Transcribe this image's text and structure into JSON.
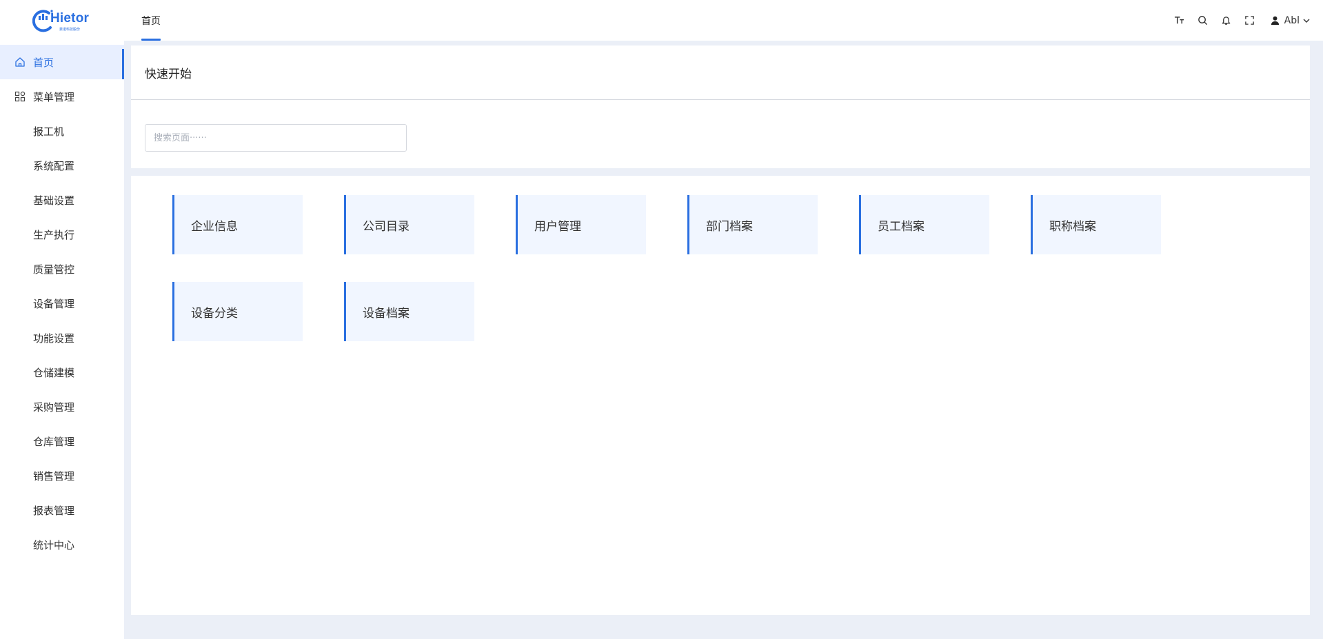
{
  "header": {
    "logo_text": "Hietor",
    "logo_subtext": "豪诺科技股份",
    "active_tab": "首页",
    "user_name": "Abl"
  },
  "sidebar": {
    "items": [
      {
        "label": "首页",
        "icon": "home-icon",
        "active": true
      },
      {
        "label": "菜单管理",
        "icon": "grid-icon",
        "active": false
      },
      {
        "label": "报工机"
      },
      {
        "label": "系统配置"
      },
      {
        "label": "基础设置"
      },
      {
        "label": "生产执行"
      },
      {
        "label": "质量管控"
      },
      {
        "label": "设备管理"
      },
      {
        "label": "功能设置"
      },
      {
        "label": "仓储建模"
      },
      {
        "label": "采购管理"
      },
      {
        "label": "仓库管理"
      },
      {
        "label": "销售管理"
      },
      {
        "label": "报表管理"
      },
      {
        "label": "统计中心"
      }
    ]
  },
  "main": {
    "title": "快速开始",
    "search": {
      "placeholder": "搜索页面······",
      "value": ""
    },
    "cards": [
      {
        "label": "企业信息"
      },
      {
        "label": "公司目录"
      },
      {
        "label": "用户管理"
      },
      {
        "label": "部门档案"
      },
      {
        "label": "员工档案"
      },
      {
        "label": "职称档案"
      },
      {
        "label": "设备分类"
      },
      {
        "label": "设备档案"
      }
    ]
  },
  "colors": {
    "accent": "#2a6fe0",
    "card_bg": "#f1f6ff",
    "page_bg": "#ebeff7",
    "active_bg": "#e8efff"
  }
}
